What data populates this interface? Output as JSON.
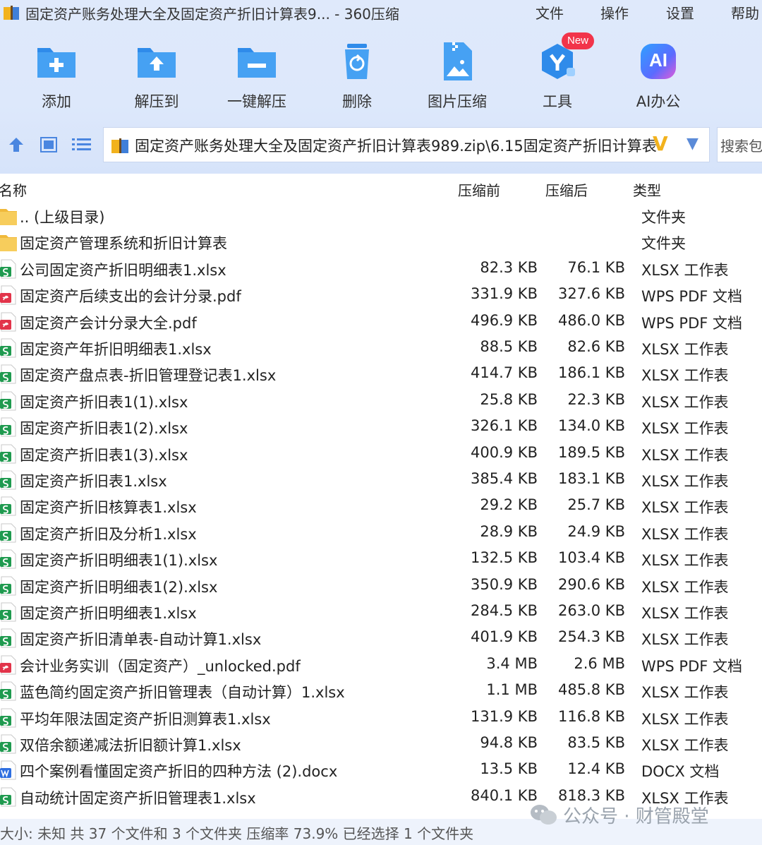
{
  "window": {
    "title": "固定资产账务处理大全及固定资产折旧计算表9... - 360压缩",
    "menu": [
      "文件",
      "操作",
      "设置",
      "帮助"
    ]
  },
  "toolbar": {
    "add": "添加",
    "extract_to": "解压到",
    "one_click": "一键解压",
    "delete": "删除",
    "image_compress": "图片压缩",
    "tools": "工具",
    "tools_badge": "New",
    "ai_office": "AI办公",
    "ai_icon_text": "AI"
  },
  "pathbar": {
    "path": "固定资产账务处理大全及固定资产折旧计算表989.zip\\6.15固定资产折旧计算表",
    "search_placeholder": "搜索包"
  },
  "columns": {
    "name": "名称",
    "before": "压缩前",
    "after": "压缩后",
    "type": "类型"
  },
  "files": [
    {
      "name": ".. (上级目录)",
      "before": "",
      "after": "",
      "type": "文件夹",
      "icon": "folder"
    },
    {
      "name": "固定资产管理系统和折旧计算表",
      "before": "",
      "after": "",
      "type": "文件夹",
      "icon": "folder"
    },
    {
      "name": "公司固定资产折旧明细表1.xlsx",
      "before": "82.3 KB",
      "after": "76.1 KB",
      "type": "XLSX 工作表",
      "icon": "xlsx"
    },
    {
      "name": "固定资产后续支出的会计分录.pdf",
      "before": "331.9 KB",
      "after": "327.6 KB",
      "type": "WPS PDF 文档",
      "icon": "pdf"
    },
    {
      "name": "固定资产会计分录大全.pdf",
      "before": "496.9 KB",
      "after": "486.0 KB",
      "type": "WPS PDF 文档",
      "icon": "pdf"
    },
    {
      "name": "固定资产年折旧明细表1.xlsx",
      "before": "88.5 KB",
      "after": "82.6 KB",
      "type": "XLSX 工作表",
      "icon": "xlsx"
    },
    {
      "name": "固定资产盘点表-折旧管理登记表1.xlsx",
      "before": "414.7 KB",
      "after": "186.1 KB",
      "type": "XLSX 工作表",
      "icon": "xlsx"
    },
    {
      "name": "固定资产折旧表1(1).xlsx",
      "before": "25.8 KB",
      "after": "22.3 KB",
      "type": "XLSX 工作表",
      "icon": "xlsx"
    },
    {
      "name": "固定资产折旧表1(2).xlsx",
      "before": "326.1 KB",
      "after": "134.0 KB",
      "type": "XLSX 工作表",
      "icon": "xlsx"
    },
    {
      "name": "固定资产折旧表1(3).xlsx",
      "before": "400.9 KB",
      "after": "189.5 KB",
      "type": "XLSX 工作表",
      "icon": "xlsx"
    },
    {
      "name": "固定资产折旧表1.xlsx",
      "before": "385.4 KB",
      "after": "183.1 KB",
      "type": "XLSX 工作表",
      "icon": "xlsx"
    },
    {
      "name": "固定资产折旧核算表1.xlsx",
      "before": "29.2 KB",
      "after": "25.7 KB",
      "type": "XLSX 工作表",
      "icon": "xlsx"
    },
    {
      "name": "固定资产折旧及分析1.xlsx",
      "before": "28.9 KB",
      "after": "24.9 KB",
      "type": "XLSX 工作表",
      "icon": "xlsx"
    },
    {
      "name": "固定资产折旧明细表1(1).xlsx",
      "before": "132.5 KB",
      "after": "103.4 KB",
      "type": "XLSX 工作表",
      "icon": "xlsx"
    },
    {
      "name": "固定资产折旧明细表1(2).xlsx",
      "before": "350.9 KB",
      "after": "290.6 KB",
      "type": "XLSX 工作表",
      "icon": "xlsx"
    },
    {
      "name": "固定资产折旧明细表1.xlsx",
      "before": "284.5 KB",
      "after": "263.0 KB",
      "type": "XLSX 工作表",
      "icon": "xlsx"
    },
    {
      "name": "固定资产折旧清单表-自动计算1.xlsx",
      "before": "401.9 KB",
      "after": "254.3 KB",
      "type": "XLSX 工作表",
      "icon": "xlsx"
    },
    {
      "name": "会计业务实训（固定资产）_unlocked.pdf",
      "before": "3.4 MB",
      "after": "2.6 MB",
      "type": "WPS PDF 文档",
      "icon": "pdf"
    },
    {
      "name": "蓝色简约固定资产折旧管理表（自动计算）1.xlsx",
      "before": "1.1 MB",
      "after": "485.8 KB",
      "type": "XLSX 工作表",
      "icon": "xlsx"
    },
    {
      "name": "平均年限法固定资产折旧测算表1.xlsx",
      "before": "131.9 KB",
      "after": "116.8 KB",
      "type": "XLSX 工作表",
      "icon": "xlsx"
    },
    {
      "name": "双倍余额递减法折旧额计算1.xlsx",
      "before": "94.8 KB",
      "after": "83.5 KB",
      "type": "XLSX 工作表",
      "icon": "xlsx"
    },
    {
      "name": "四个案例看懂固定资产折旧的四种方法 (2).docx",
      "before": "13.5 KB",
      "after": "12.4 KB",
      "type": "DOCX 文档",
      "icon": "docx"
    },
    {
      "name": "自动统计固定资产折旧管理表1.xlsx",
      "before": "840.1 KB",
      "after": "818.3 KB",
      "type": "XLSX 工作表",
      "icon": "xlsx"
    }
  ],
  "status": {
    "text": "大小: 未知 共 37 个文件和 3 个文件夹 压缩率 73.9% 已经选择 1 个文件夹"
  },
  "watermark": {
    "text": "公众号 · 财管殿堂"
  },
  "colors": {
    "accent_blue": "#2f8bea",
    "xlsx_green": "#1f9a4f",
    "pdf_red": "#e2344a",
    "docx_blue": "#2f6fe0",
    "folder_yellow": "#f5c64a"
  }
}
